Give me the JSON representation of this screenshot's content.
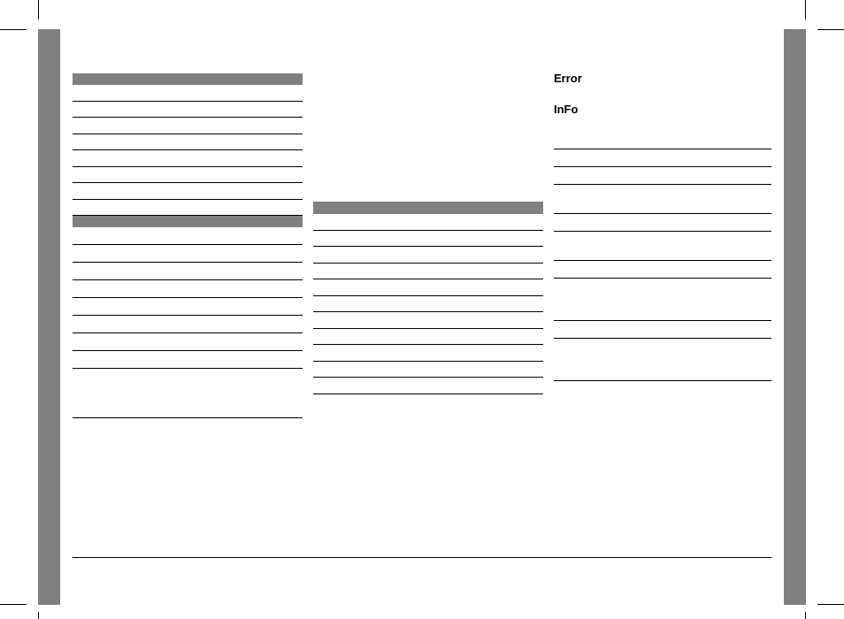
{
  "right_column": {
    "heading_error": "Error",
    "heading_info": "InFo"
  },
  "tables": {
    "col1_a_rows": 8,
    "col1_b_rows": 8,
    "col2_rows": 11
  }
}
